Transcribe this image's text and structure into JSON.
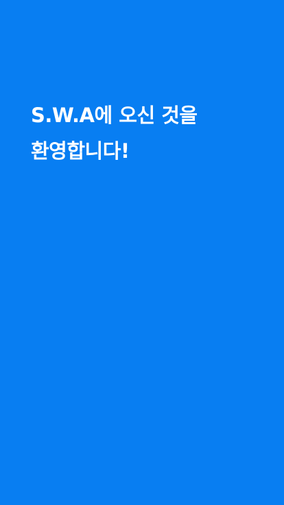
{
  "theme": {
    "background_color": "#087EF2",
    "text_color": "#FFFFFF"
  },
  "welcome": {
    "line1": "S.W.A에 오신 것을",
    "line2": "환영합니다!"
  }
}
